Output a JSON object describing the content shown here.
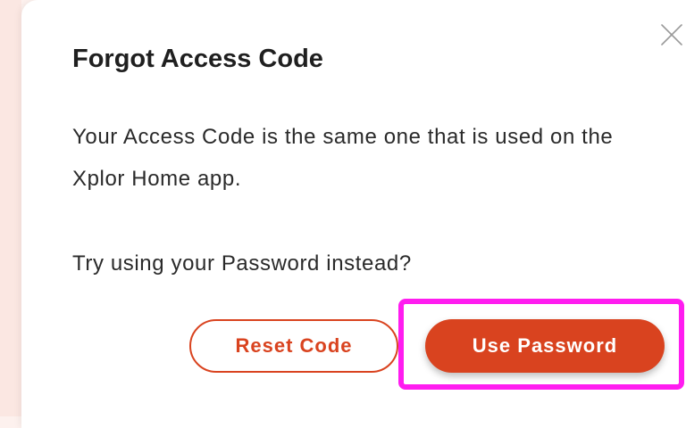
{
  "dialog": {
    "title": "Forgot Access Code",
    "message": "Your Access Code is the same one that is used on the Xplor Home app.",
    "prompt": "Try using your Password instead?",
    "close_icon": "close-icon",
    "reset_label": "Reset Code",
    "password_label": "Use Password"
  },
  "colors": {
    "accent": "#d9431f",
    "highlight": "#ff1cf0",
    "backdrop": "#fdf1ee"
  }
}
